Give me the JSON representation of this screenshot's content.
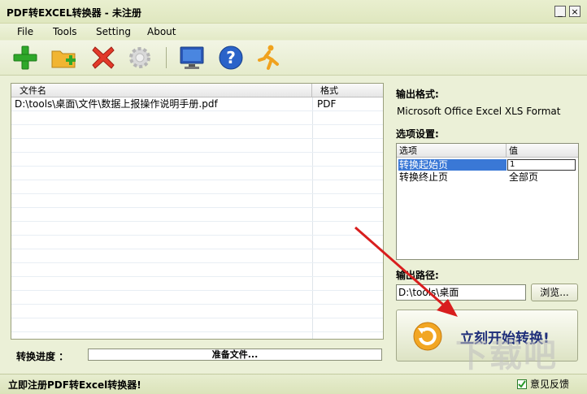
{
  "window": {
    "title": "PDF转EXCEL转换器 - 未注册",
    "min": "_",
    "close": "×"
  },
  "menu": [
    "File",
    "Tools",
    "Setting",
    "About"
  ],
  "file_table": {
    "headers": [
      "文件名",
      "格式"
    ],
    "rows": [
      {
        "name": "D:\\tools\\桌面\\文件\\数据上报操作说明手册.pdf",
        "format": "PDF"
      }
    ]
  },
  "output": {
    "format_label": "输出格式:",
    "format_value": "Microsoft Office Excel XLS Format",
    "options_label": "选项设置:",
    "option_headers": [
      "选项",
      "值"
    ],
    "options": [
      {
        "name": "转换起始页",
        "value": "1"
      },
      {
        "name": "转换终止页",
        "value": "全部页"
      }
    ],
    "path_label": "输出路径:",
    "path_value": "D:\\tools\\桌面",
    "browse_label": "浏览..."
  },
  "start_button": {
    "label": "立刻开始转换!"
  },
  "progress": {
    "label": "转换进度 ：",
    "status": "准备文件..."
  },
  "status": {
    "register": "立即注册PDF转Excel转换器!",
    "feedback": "意见反馈"
  },
  "watermark": "下载吧",
  "colors": {
    "accent": "#3a78d6",
    "arrow": "#d81e1e",
    "selected_row": "#3a78d6"
  }
}
